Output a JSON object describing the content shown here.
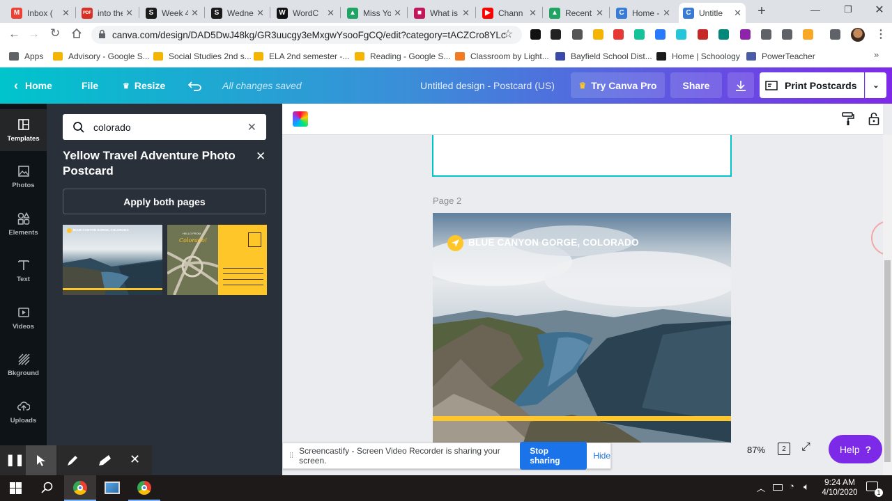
{
  "browser": {
    "tabs": [
      {
        "title": "Inbox (",
        "icon": "gmail-icon",
        "color": "#ea4335",
        "glyph": "M"
      },
      {
        "title": "into the",
        "icon": "pdf-icon",
        "color": "#d93025",
        "glyph": "PDF"
      },
      {
        "title": "Week 4",
        "icon": "schoology-icon",
        "color": "#1b1b1b",
        "glyph": "S"
      },
      {
        "title": "Wedne",
        "icon": "schoology-icon",
        "color": "#1b1b1b",
        "glyph": "S"
      },
      {
        "title": "WordC",
        "icon": "wordcloud-icon",
        "color": "#111111",
        "glyph": "W"
      },
      {
        "title": "Miss Yo",
        "icon": "drive-icon",
        "color": "#1fa463",
        "glyph": "▲"
      },
      {
        "title": "What is",
        "icon": "multicolor-icon",
        "color": "#c2185b",
        "glyph": "■"
      },
      {
        "title": "Chann",
        "icon": "youtube-icon",
        "color": "#ff0000",
        "glyph": "▶"
      },
      {
        "title": "Recent",
        "icon": "drive-icon",
        "color": "#1fa463",
        "glyph": "▲"
      },
      {
        "title": "Home -",
        "icon": "canva-icon",
        "color": "#3a7bd5",
        "glyph": "C"
      },
      {
        "title": "Untitle",
        "icon": "canva-icon",
        "color": "#3a7bd5",
        "glyph": "C"
      }
    ],
    "url": "canva.com/design/DAD5DwJ48kg/GR3uucgy3eMxgwYsooFgCQ/edit?category=tACZCro8YLc",
    "bookmarks": [
      {
        "label": "Apps",
        "color": "#5f6368"
      },
      {
        "label": "Advisory - Google S...",
        "color": "#f4b400"
      },
      {
        "label": "Social Studies 2nd s...",
        "color": "#f4b400"
      },
      {
        "label": "ELA 2nd semester -...",
        "color": "#f4b400"
      },
      {
        "label": "Reading - Google S...",
        "color": "#f4b400"
      },
      {
        "label": "Classroom by Light...",
        "color": "#f47a20"
      },
      {
        "label": "Bayfield School Dist...",
        "color": "#3949ab"
      },
      {
        "label": "Home | Schoology",
        "color": "#1b1b1b"
      },
      {
        "label": "PowerTeacher",
        "color": "#4a5ba8"
      }
    ]
  },
  "canva": {
    "header": {
      "home": "Home",
      "file": "File",
      "resize": "Resize",
      "saved": "All changes saved",
      "doc_title": "Untitled design - Postcard (US)",
      "try_pro": "Try Canva Pro",
      "share": "Share",
      "print": "Print Postcards"
    },
    "rail": [
      {
        "label": "Templates"
      },
      {
        "label": "Photos"
      },
      {
        "label": "Elements"
      },
      {
        "label": "Text"
      },
      {
        "label": "Videos"
      },
      {
        "label": "Bkground"
      },
      {
        "label": "Uploads"
      }
    ],
    "panel": {
      "search_value": "colorado",
      "template_title": "Yellow Travel Adventure Photo Postcard",
      "apply_label": "Apply both pages",
      "thumb1_caption": "BLUE CANYON GORGE, COLORADO",
      "thumb2_caption_top": "HELLO FROM",
      "thumb2_caption": "Colorado!"
    },
    "canvas": {
      "page_label": "Page 2",
      "card_title": "BLUE CANYON GORGE, COLORADO",
      "zoom": "87%",
      "page_count": "2",
      "help": "Help"
    },
    "accent": "#ffc629"
  },
  "screencastify": {
    "message": "Screencastify - Screen Video Recorder is sharing your screen.",
    "stop": "Stop sharing",
    "hide": "Hide"
  },
  "taskbar": {
    "time": "9:24 AM",
    "date": "4/10/2020",
    "notifications": "1"
  }
}
